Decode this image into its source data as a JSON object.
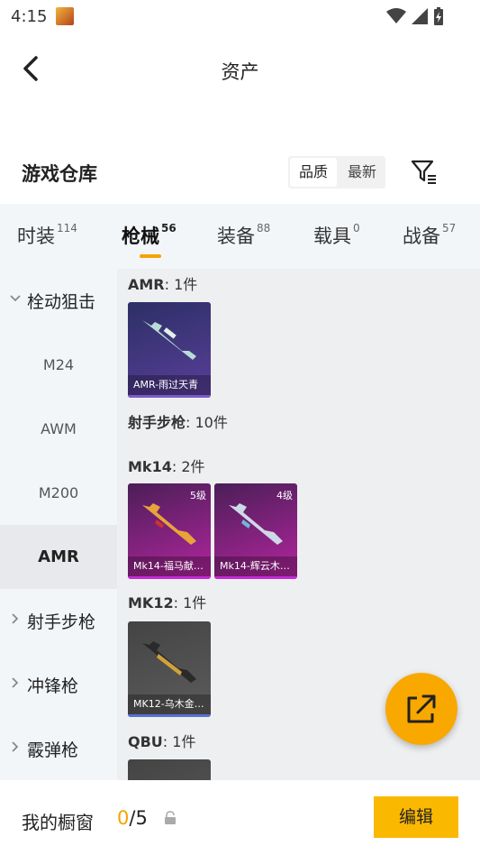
{
  "status_bar": {
    "time": "4:15"
  },
  "header": {
    "title": "资产"
  },
  "section": {
    "title": "游戏仓库",
    "sort_options": [
      "品质",
      "最新"
    ],
    "active_sort": "品质"
  },
  "tabs": [
    {
      "label": "时装",
      "count": "114"
    },
    {
      "label": "枪械",
      "count": "56"
    },
    {
      "label": "装备",
      "count": "88"
    },
    {
      "label": "载具",
      "count": "0"
    },
    {
      "label": "战备",
      "count": "57"
    }
  ],
  "active_tab": "枪械",
  "sidebar": {
    "groups": [
      {
        "label": "栓动狙击",
        "expanded": true,
        "children": [
          "M24",
          "AWM",
          "M200",
          "AMR"
        ]
      },
      {
        "label": "射手步枪",
        "expanded": false
      },
      {
        "label": "冲锋枪",
        "expanded": false
      },
      {
        "label": "霰弹枪",
        "expanded": false
      }
    ],
    "active_item": "AMR"
  },
  "content": {
    "sections": [
      {
        "name": "AMR",
        "count": "1件",
        "items": [
          {
            "label": "AMR-雨过天青",
            "level": ""
          }
        ]
      },
      {
        "name": "射手步枪",
        "count": "10件",
        "items": []
      },
      {
        "name": "Mk14",
        "count": "2件",
        "items": [
          {
            "label": "Mk14-福马献…",
            "level": "5级"
          },
          {
            "label": "Mk14-辉云木…",
            "level": "4级"
          }
        ]
      },
      {
        "name": "MK12",
        "count": "1件",
        "items": [
          {
            "label": "MK12-乌木金…",
            "level": ""
          }
        ]
      },
      {
        "name": "QBU",
        "count": "1件",
        "items": []
      }
    ]
  },
  "bottom_bar": {
    "showcase_label": "我的橱窗",
    "showcase_used": "0",
    "showcase_total": "/5",
    "edit_label": "编辑"
  },
  "colors": {
    "accent": "#f5a300",
    "rarity_purple": "#7b5cc8",
    "rarity_pink": "#c42ad6",
    "rarity_blue": "#5a6fd0"
  }
}
